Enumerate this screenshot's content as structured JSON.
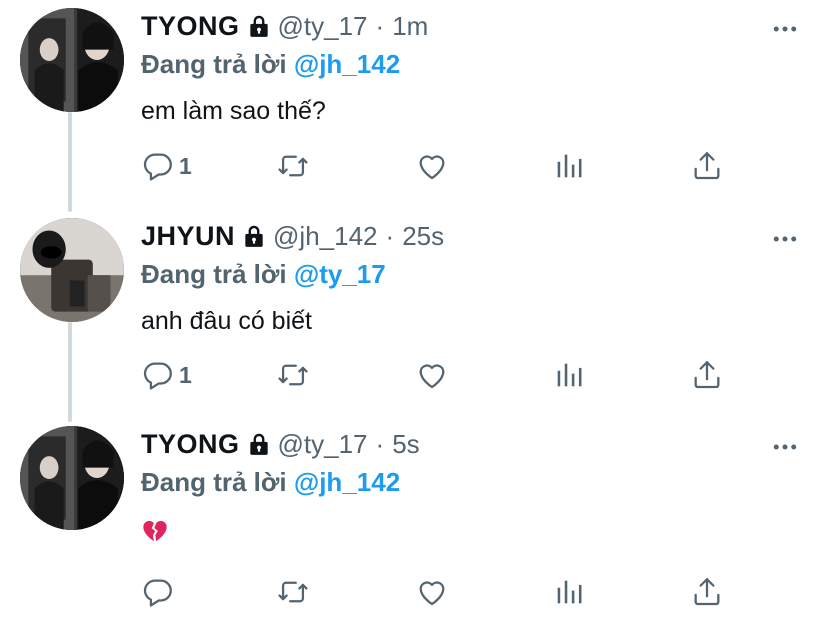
{
  "tweets": [
    {
      "name": "TYONG",
      "handle": "@ty_17",
      "time": "1m",
      "reply_prefix": "Đang trả lời",
      "reply_to": "@jh_142",
      "text": "em làm sao thế?",
      "reply_count": "1"
    },
    {
      "name": "JHYUN",
      "handle": "@jh_142",
      "time": "25s",
      "reply_prefix": "Đang trả lời",
      "reply_to": "@ty_17",
      "text": "anh đâu có biết",
      "reply_count": "1"
    },
    {
      "name": "TYONG",
      "handle": "@ty_17",
      "time": "5s",
      "reply_prefix": "Đang trả lời",
      "reply_to": "@jh_142",
      "text": "",
      "emoji": "broken-heart",
      "reply_count": ""
    }
  ],
  "colors": {
    "text": "#0f1419",
    "secondary": "#536471",
    "mention": "#1d9bf0",
    "thread_line": "#cfd9de",
    "broken_heart": "#e0245e"
  },
  "icons": [
    "lock-icon",
    "more-icon",
    "reply-icon",
    "retweet-icon",
    "like-icon",
    "analytics-icon",
    "share-icon",
    "broken-heart-emoji"
  ]
}
